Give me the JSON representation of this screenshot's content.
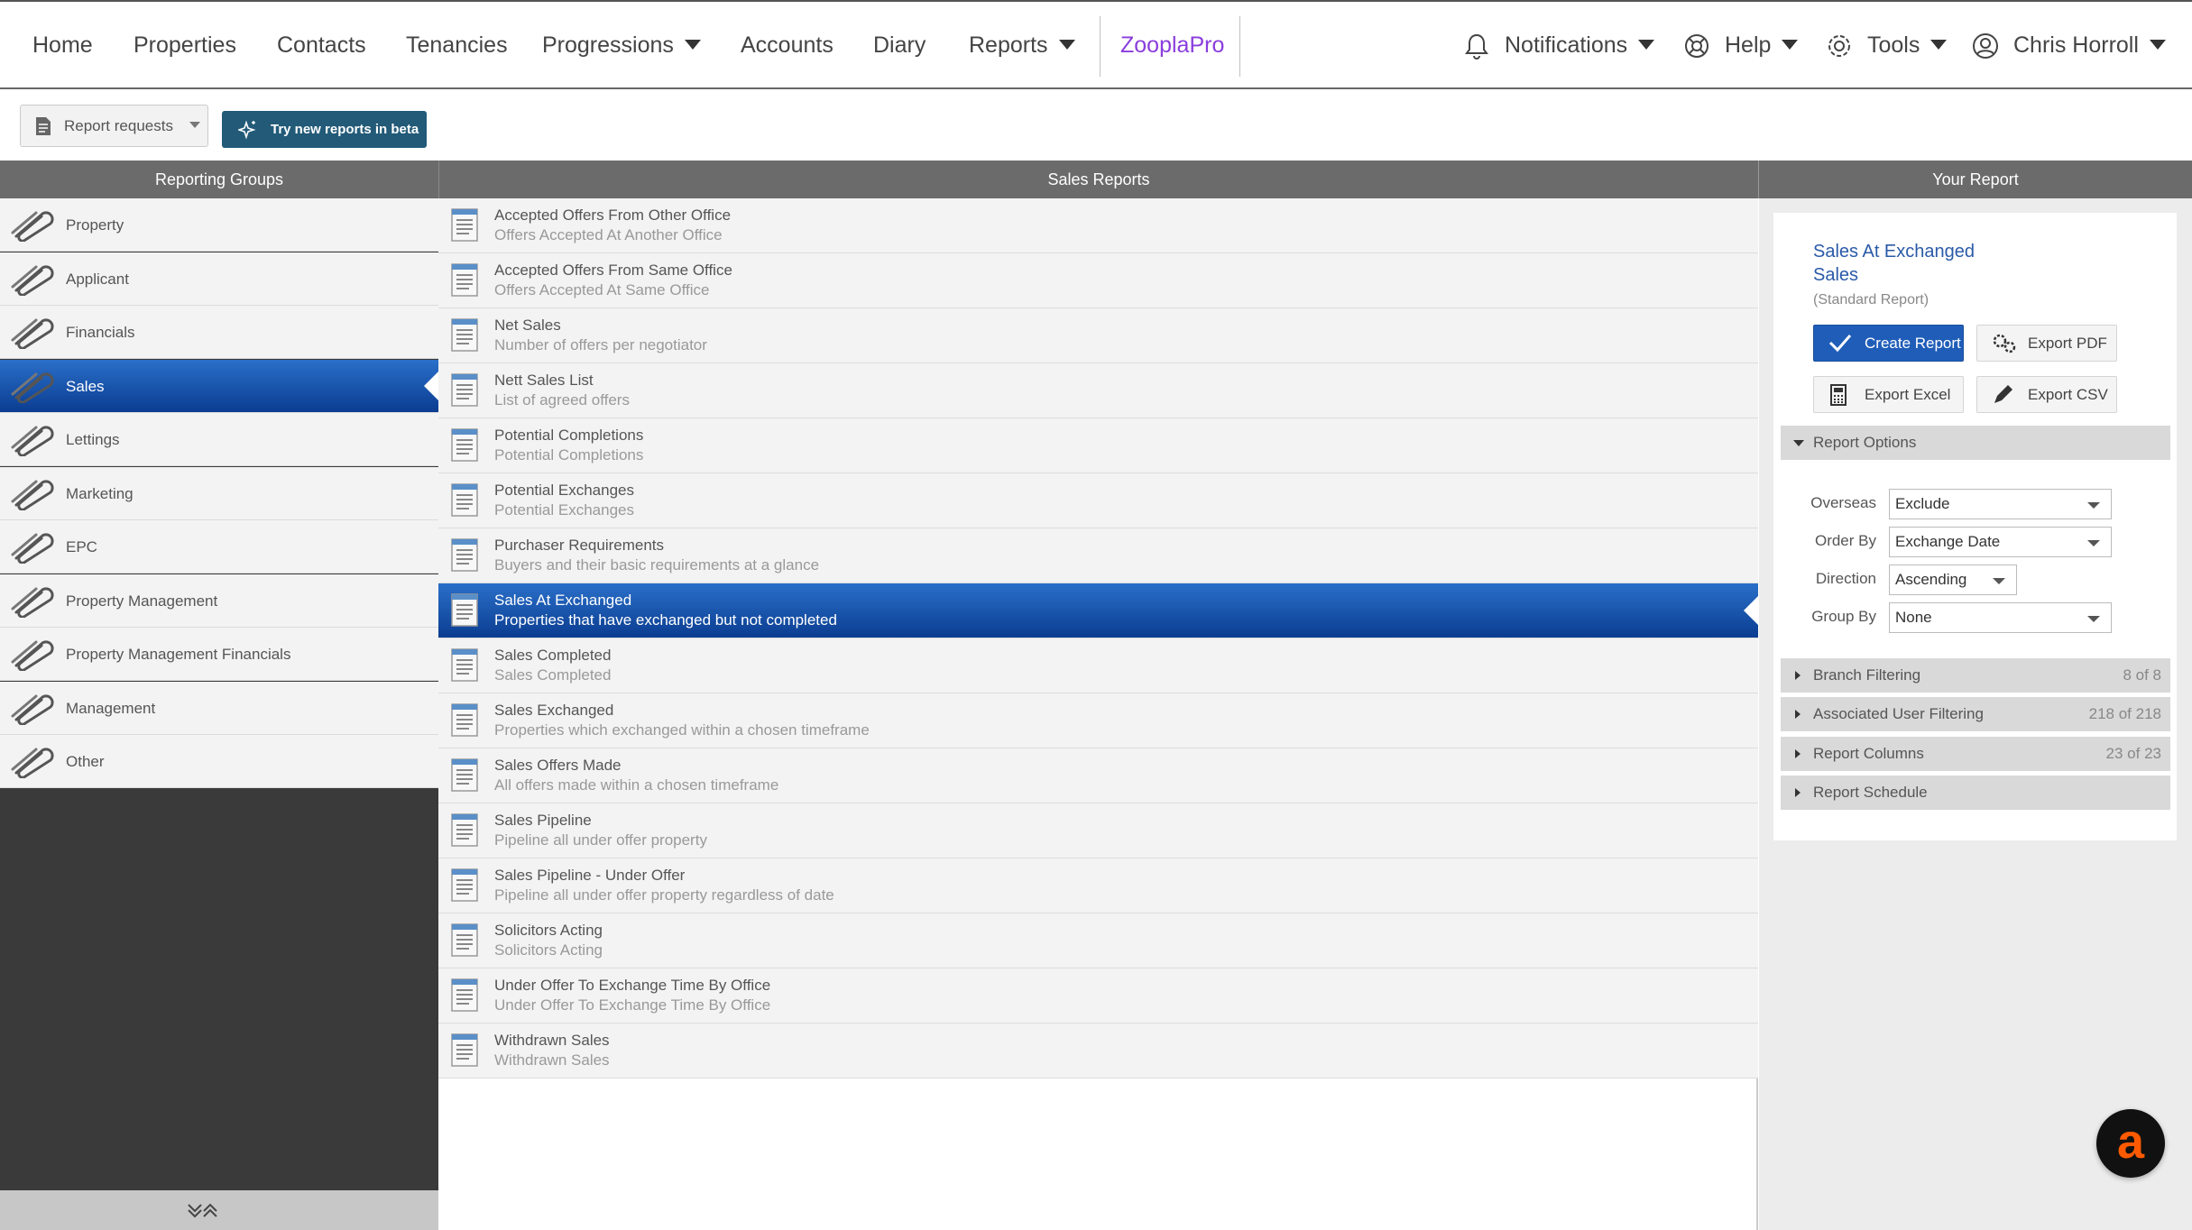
{
  "nav": {
    "home": "Home",
    "properties": "Properties",
    "contacts": "Contacts",
    "tenancies": "Tenancies",
    "progressions": "Progressions",
    "accounts": "Accounts",
    "diary": "Diary",
    "reports": "Reports",
    "zooplapro": "ZooplaPro",
    "notifications": "Notifications",
    "help": "Help",
    "tools": "Tools",
    "user": "Chris Horroll"
  },
  "toolbar": {
    "report_requests": "Report requests",
    "beta": "Try new reports in beta"
  },
  "columns": {
    "groups": "Reporting Groups",
    "reports": "Sales Reports",
    "your_report": "Your Report"
  },
  "groups": [
    "Property",
    "Applicant",
    "Financials",
    "Sales",
    "Lettings",
    "Marketing",
    "EPC",
    "Property Management",
    "Property Management Financials",
    "Management",
    "Other"
  ],
  "active_group": "Sales",
  "reports": [
    {
      "title": "Accepted Offers From Other Office",
      "desc": "Offers Accepted At Another Office"
    },
    {
      "title": "Accepted Offers From Same Office",
      "desc": "Offers Accepted At Same Office"
    },
    {
      "title": "Net Sales",
      "desc": "Number of offers per negotiator"
    },
    {
      "title": "Nett Sales List",
      "desc": "List of agreed offers"
    },
    {
      "title": "Potential Completions",
      "desc": "Potential Completions"
    },
    {
      "title": "Potential Exchanges",
      "desc": "Potential Exchanges"
    },
    {
      "title": "Purchaser Requirements",
      "desc": "Buyers and their basic requirements at a glance"
    },
    {
      "title": "Sales At Exchanged",
      "desc": "Properties that have exchanged but not completed"
    },
    {
      "title": "Sales Completed",
      "desc": "Sales Completed"
    },
    {
      "title": "Sales Exchanged",
      "desc": "Properties which exchanged within a chosen timeframe"
    },
    {
      "title": "Sales Offers Made",
      "desc": "All offers made within a chosen timeframe"
    },
    {
      "title": "Sales Pipeline",
      "desc": "Pipeline all under offer property"
    },
    {
      "title": "Sales Pipeline - Under Offer",
      "desc": "Pipeline all under offer property regardless of date"
    },
    {
      "title": "Solicitors Acting",
      "desc": "Solicitors Acting"
    },
    {
      "title": "Under Offer To Exchange Time By Office",
      "desc": "Under Offer To Exchange Time By Office"
    },
    {
      "title": "Withdrawn Sales",
      "desc": "Withdrawn Sales"
    }
  ],
  "active_report": "Sales At Exchanged",
  "your_report": {
    "title": "Sales At Exchanged Sales",
    "subtitle": "(Standard Report)",
    "create": "Create Report",
    "export_pdf": "Export PDF",
    "export_excel": "Export Excel",
    "export_csv": "Export CSV",
    "options_title": "Report Options",
    "options": {
      "overseas_label": "Overseas",
      "overseas_value": "Exclude",
      "orderby_label": "Order By",
      "orderby_value": "Exchange Date",
      "direction_label": "Direction",
      "direction_value": "Ascending",
      "groupby_label": "Group By",
      "groupby_value": "None"
    },
    "sections": [
      {
        "label": "Branch Filtering",
        "count": "8 of 8"
      },
      {
        "label": "Associated User Filtering",
        "count": "218 of 218"
      },
      {
        "label": "Report Columns",
        "count": "23 of 23"
      },
      {
        "label": "Report Schedule",
        "count": ""
      }
    ]
  },
  "colors": {
    "active_blue": "#1f5db8",
    "zoopla_purple": "#8a3ddc",
    "beta_btn": "#225a78",
    "chat_accent": "#ff5a00"
  }
}
